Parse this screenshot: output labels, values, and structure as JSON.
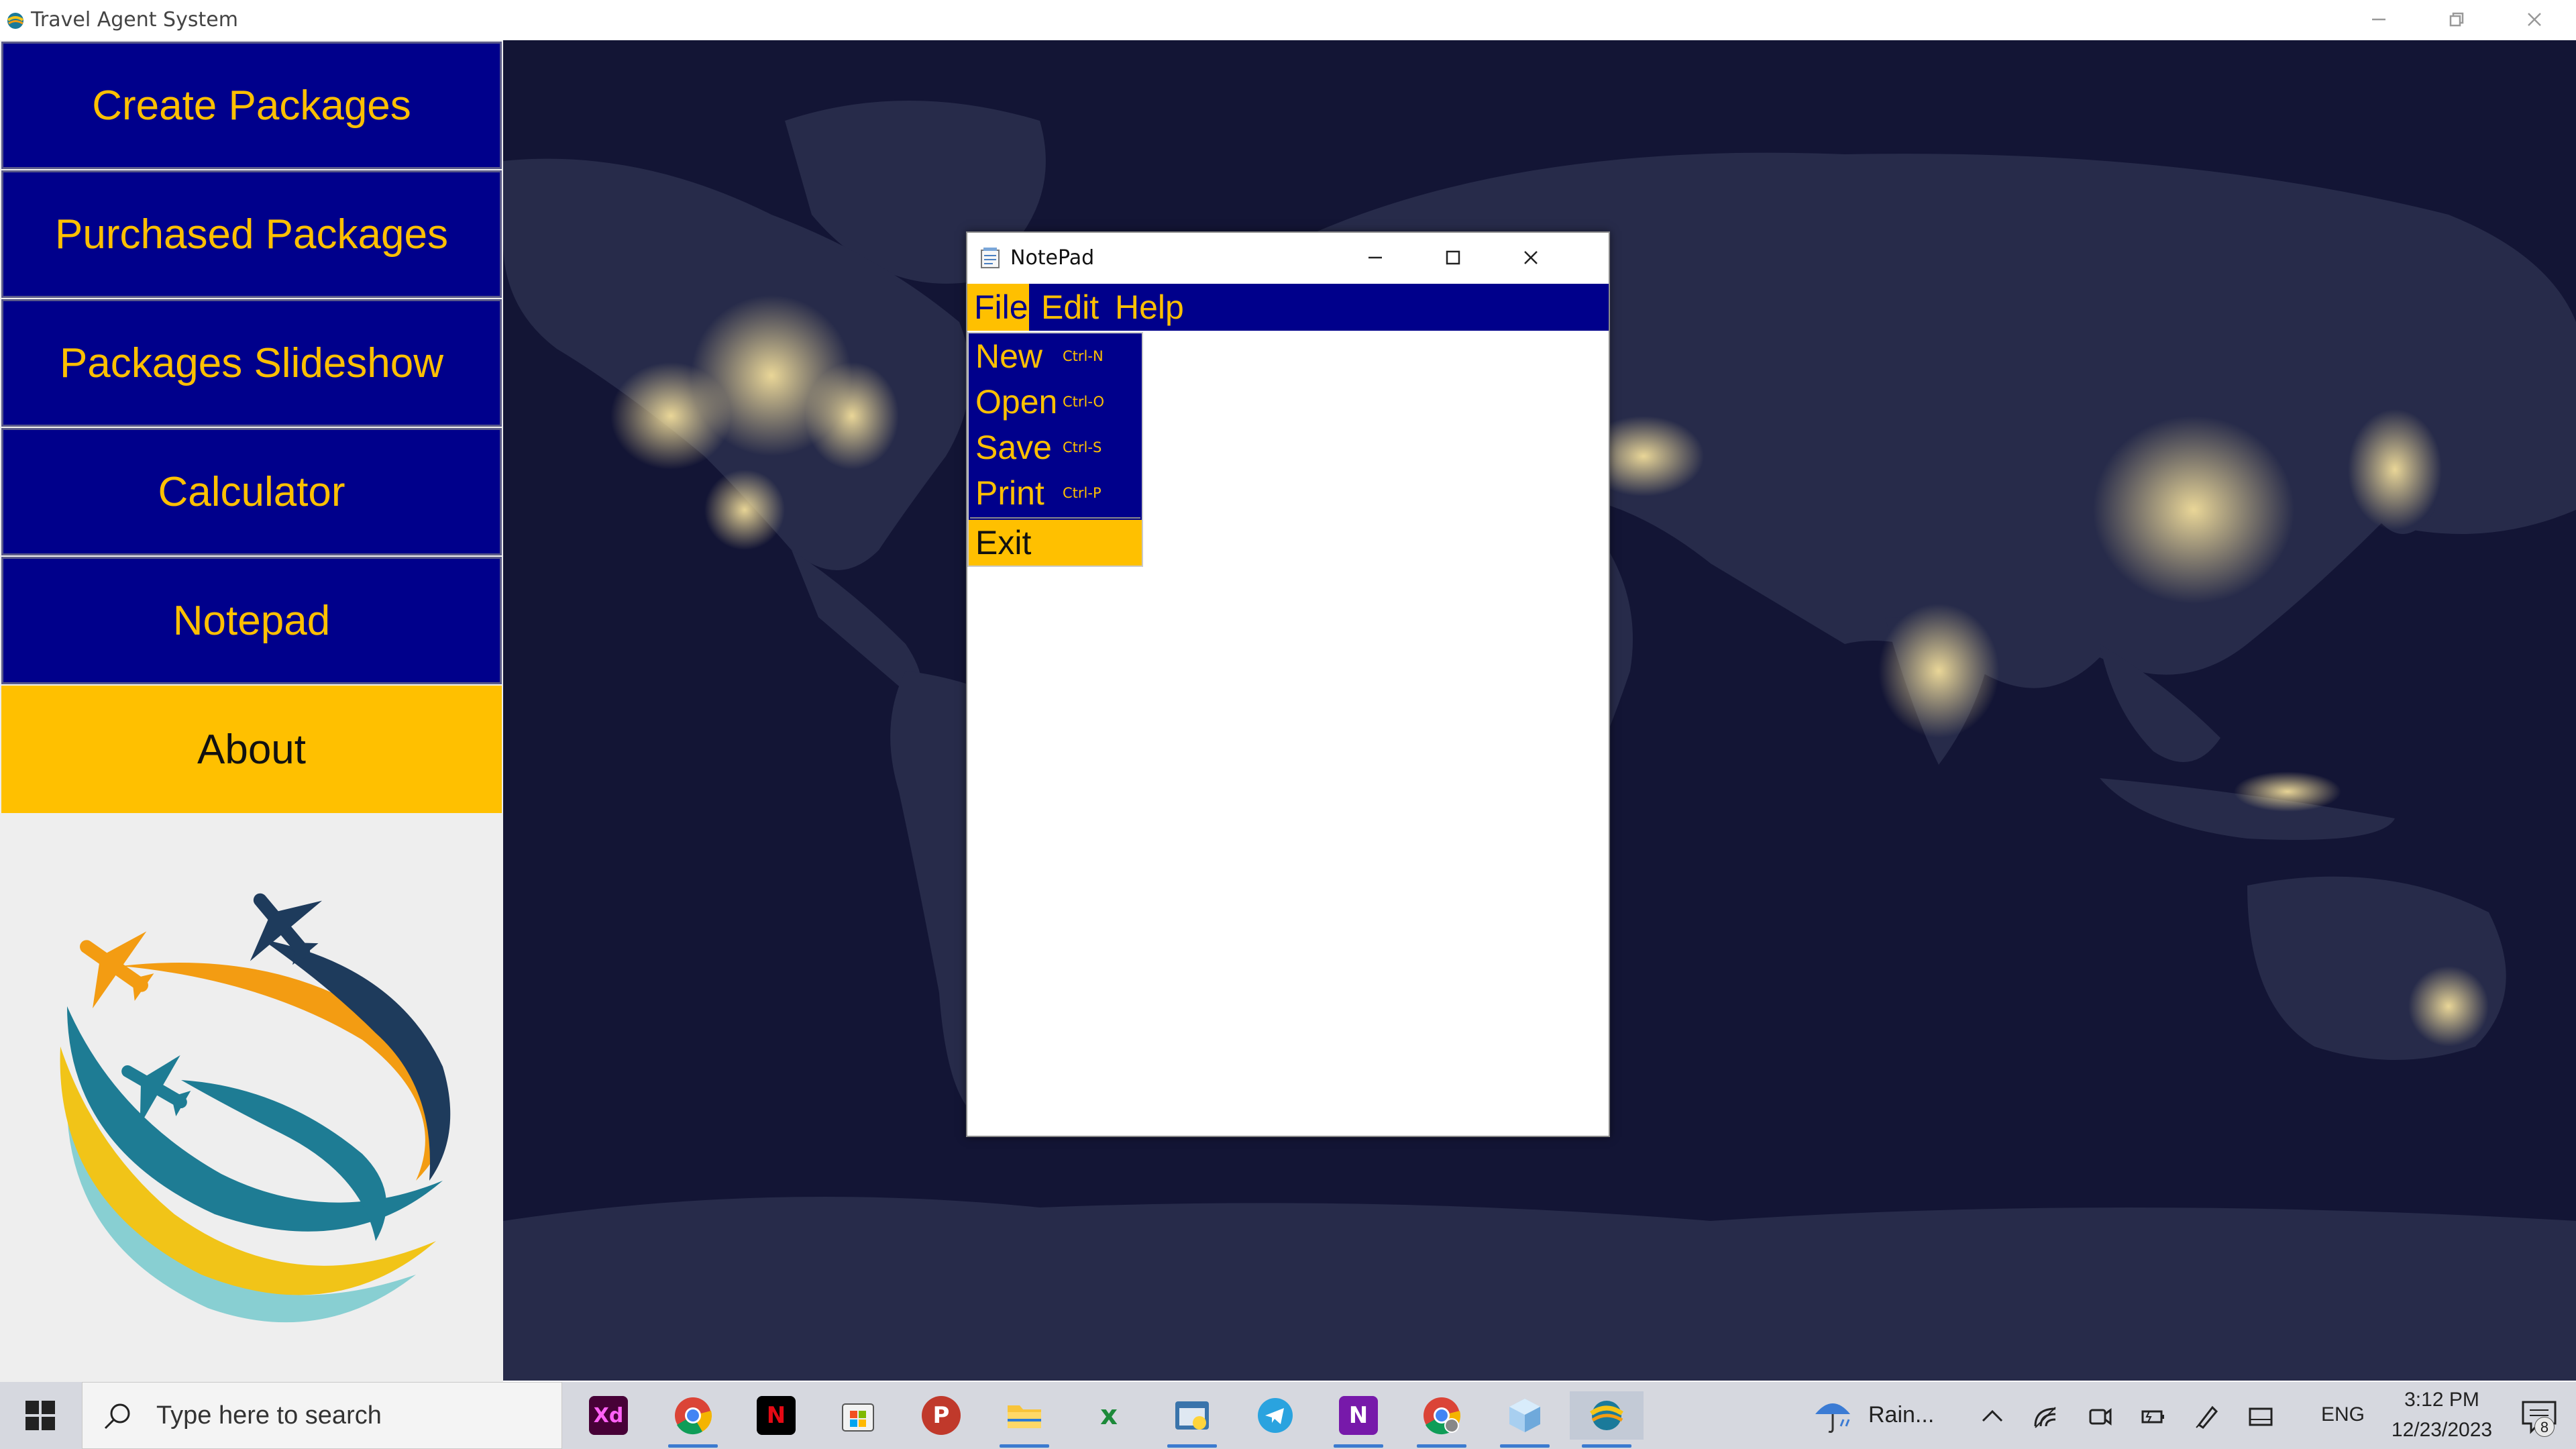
{
  "window": {
    "title": "Travel Agent System"
  },
  "sidebar": {
    "items": [
      {
        "label": "Create Packages"
      },
      {
        "label": "Purchased Packages"
      },
      {
        "label": "Packages Slideshow"
      },
      {
        "label": "Calculator"
      },
      {
        "label": "Notepad"
      },
      {
        "label": "About"
      }
    ],
    "active_item": "About"
  },
  "notepad": {
    "title": "NotePad",
    "menu": [
      {
        "label": "File"
      },
      {
        "label": "Edit"
      },
      {
        "label": "Help"
      }
    ],
    "open_menu": "File",
    "file_menu": [
      {
        "label": "New",
        "shortcut": "Ctrl-N"
      },
      {
        "label": "Open",
        "shortcut": "Ctrl-O"
      },
      {
        "label": "Save",
        "shortcut": "Ctrl-S"
      },
      {
        "label": "Print",
        "shortcut": "Ctrl-P"
      },
      {
        "label": "Exit",
        "shortcut": ""
      }
    ],
    "highlighted_item": "Exit",
    "text_content": ""
  },
  "taskbar": {
    "search_placeholder": "Type here to search",
    "apps": [
      {
        "name": "adobe-xd",
        "label": "Xd",
        "bg": "#470137",
        "fg": "#ff61f6"
      },
      {
        "name": "chrome",
        "label": "",
        "bg": "transparent",
        "fg": "#000"
      },
      {
        "name": "netflix",
        "label": "N",
        "bg": "#000000",
        "fg": "#e50914"
      },
      {
        "name": "microsoft-store",
        "label": "",
        "bg": "transparent",
        "fg": "#000"
      },
      {
        "name": "psiphon",
        "label": "P",
        "bg": "#c0392b",
        "fg": "#ffffff"
      },
      {
        "name": "file-explorer",
        "label": "",
        "bg": "transparent",
        "fg": "#000"
      },
      {
        "name": "excel-like",
        "label": "x",
        "bg": "transparent",
        "fg": "#1d8a3a"
      },
      {
        "name": "python",
        "label": "",
        "bg": "transparent",
        "fg": "#000"
      },
      {
        "name": "telegram",
        "label": "",
        "bg": "#2aa3df",
        "fg": "#ffffff"
      },
      {
        "name": "onenote",
        "label": "N",
        "bg": "#7719aa",
        "fg": "#ffffff"
      },
      {
        "name": "chrome-profile",
        "label": "",
        "bg": "transparent",
        "fg": "#000"
      },
      {
        "name": "virtual-box",
        "label": "",
        "bg": "transparent",
        "fg": "#000"
      },
      {
        "name": "travel-agent",
        "label": "",
        "bg": "transparent",
        "fg": "#000"
      }
    ],
    "weather": "Rain...",
    "language": "ENG",
    "time": "3:12 PM",
    "date": "12/23/2023",
    "notification_count": "8"
  },
  "colors": {
    "menu_blue": "#00008b",
    "accent_gold": "#ffc000",
    "map_night": "#141638"
  }
}
